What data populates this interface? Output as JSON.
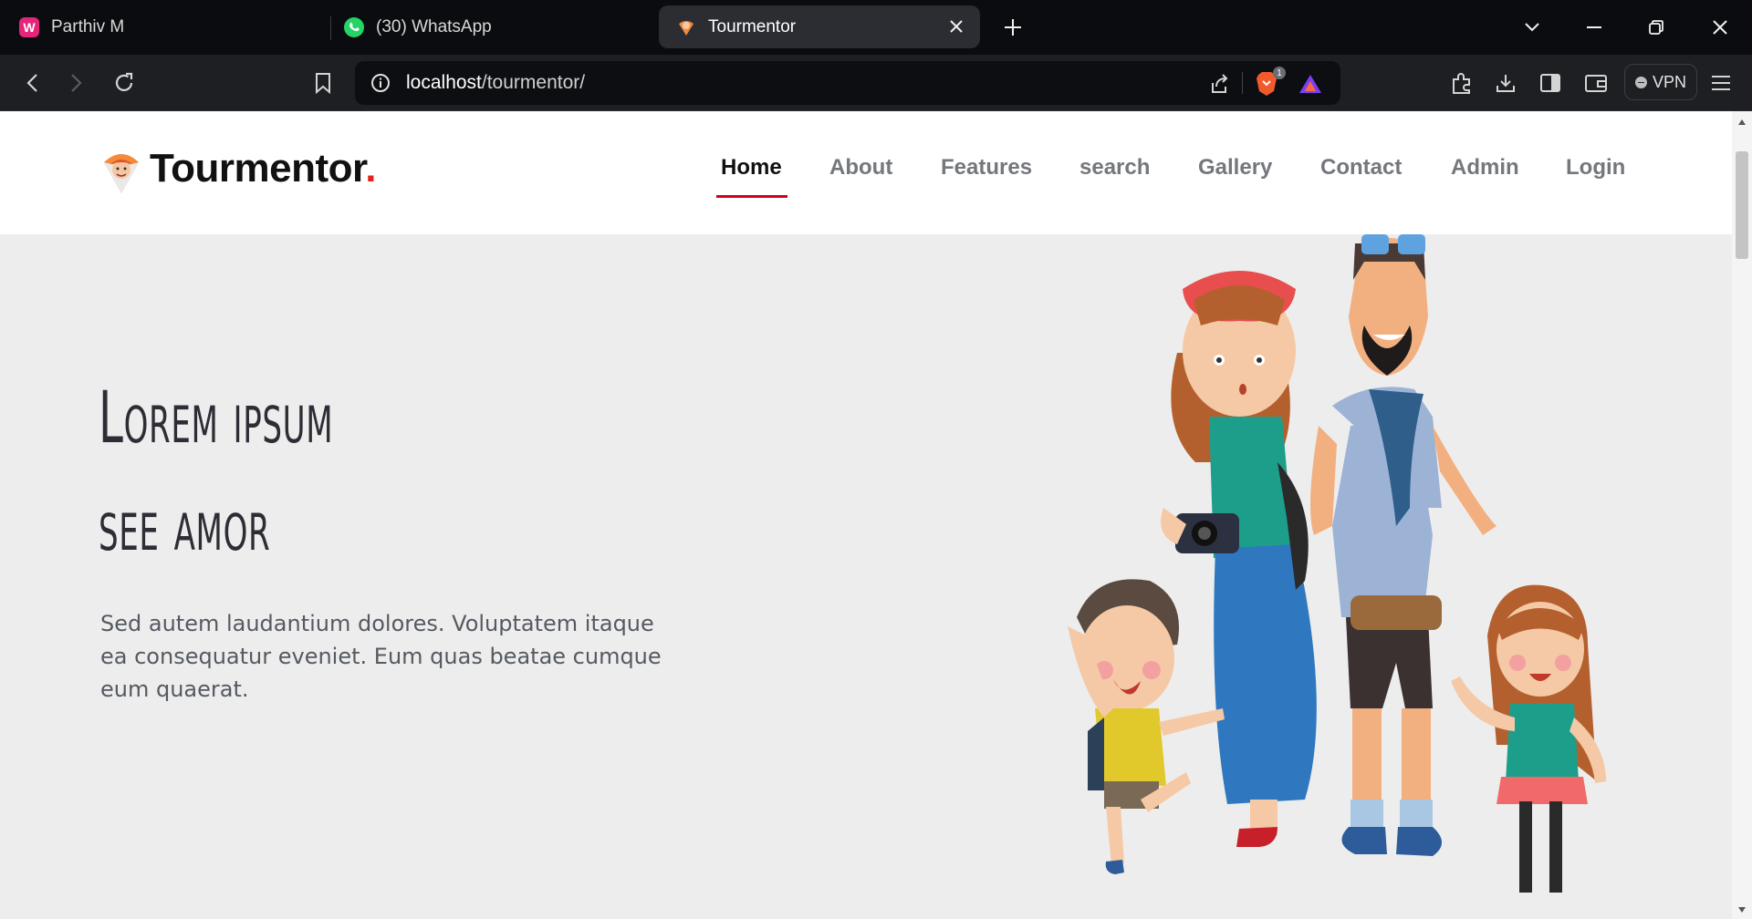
{
  "browser": {
    "tabs": [
      {
        "title": "Parthiv M",
        "icon": "wamp-icon"
      },
      {
        "title": "(30) WhatsApp",
        "icon": "whatsapp-icon"
      },
      {
        "title": "Tourmentor",
        "icon": "tourmentor-favicon",
        "active": true
      }
    ],
    "url_host": "localhost",
    "url_path": "/tourmentor/",
    "vpn_label": "VPN",
    "brave_badge": "1"
  },
  "site": {
    "logo_text": "Tourmentor",
    "logo_dot": ".",
    "nav": [
      {
        "label": "Home",
        "active": true
      },
      {
        "label": "About"
      },
      {
        "label": "Features"
      },
      {
        "label": "search"
      },
      {
        "label": "Gallery"
      },
      {
        "label": "Contact"
      },
      {
        "label": "Admin"
      },
      {
        "label": "Login"
      }
    ],
    "hero": {
      "title_line1": "Lorem ipsum",
      "title_line2": "see amor",
      "text": "Sed autem laudantium dolores. Voluptatem itaque ea consequatur eveniet. Eum quas beatae cumque eum quaerat."
    }
  },
  "colors": {
    "accent_red": "#d0021b",
    "tab_bar": "#0b0c10",
    "toolbar": "#1e1f23",
    "hero_bg": "#ededed"
  }
}
